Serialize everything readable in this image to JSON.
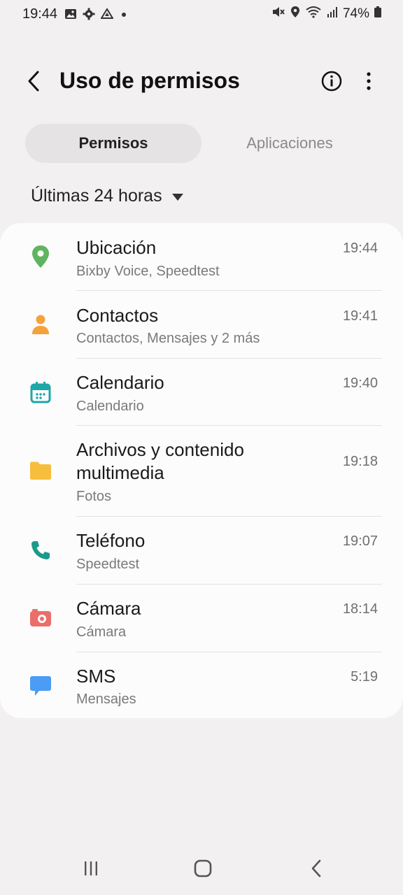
{
  "status_bar": {
    "time": "19:44",
    "battery": "74%",
    "left_icons": [
      "image-icon",
      "gear-icon",
      "drive-icon",
      "dot-icon"
    ],
    "right_icons": [
      "mute-icon",
      "location-icon",
      "wifi-icon",
      "signal-icon",
      "battery-icon"
    ]
  },
  "app_bar": {
    "title": "Uso de permisos"
  },
  "tabs": [
    {
      "label": "Permisos",
      "selected": true
    },
    {
      "label": "Aplicaciones",
      "selected": false
    }
  ],
  "time_range": {
    "label": "Últimas 24 horas"
  },
  "colors": {
    "location": "#5fb55f",
    "contacts": "#f5a23a",
    "calendar": "#1fa6a6",
    "files": "#f7be3d",
    "phone": "#1a9a8a",
    "camera": "#ea6f6a",
    "sms": "#4a9cf5"
  },
  "permissions": [
    {
      "name": "Ubicación",
      "apps": "Bixby Voice, Speedtest",
      "time": "19:44",
      "icon": "location-pin-icon"
    },
    {
      "name": "Contactos",
      "apps": "Contactos, Mensajes y 2 más",
      "time": "19:41",
      "icon": "person-icon"
    },
    {
      "name": "Calendario",
      "apps": "Calendario",
      "time": "19:40",
      "icon": "calendar-icon"
    },
    {
      "name": "Archivos y contenido multimedia",
      "apps": "Fotos",
      "time": "19:18",
      "icon": "folder-icon"
    },
    {
      "name": "Teléfono",
      "apps": "Speedtest",
      "time": "19:07",
      "icon": "phone-icon"
    },
    {
      "name": "Cámara",
      "apps": "Cámara",
      "time": "18:14",
      "icon": "camera-icon"
    },
    {
      "name": "SMS",
      "apps": "Mensajes",
      "time": "5:19",
      "icon": "message-icon"
    }
  ]
}
